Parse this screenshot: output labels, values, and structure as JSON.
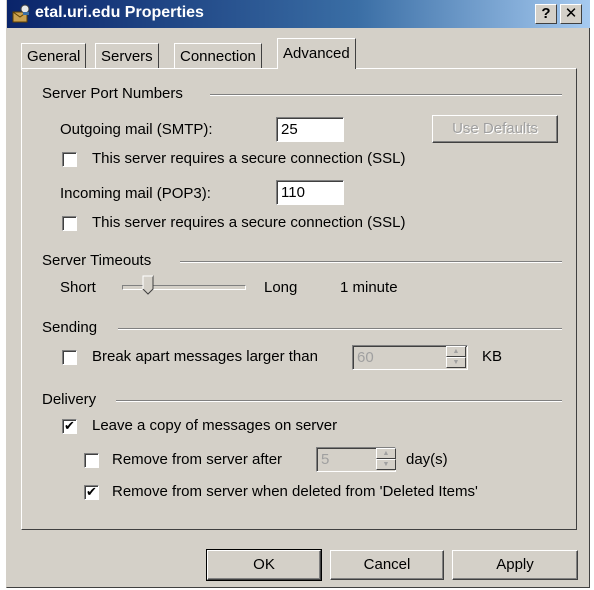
{
  "window": {
    "title": "etal.uri.edu Properties",
    "help_label": "?",
    "close_label": "✕"
  },
  "tabs": [
    {
      "label": "General",
      "active": false
    },
    {
      "label": "Servers",
      "active": false
    },
    {
      "label": "Connection",
      "active": false
    },
    {
      "label": "Advanced",
      "active": true
    }
  ],
  "server_ports": {
    "heading": "Server Port Numbers",
    "smtp_label": "Outgoing mail (SMTP):",
    "smtp_value": "25",
    "use_defaults_label": "Use Defaults",
    "smtp_ssl_label": "This server requires a secure connection (SSL)",
    "smtp_ssl_checked": false,
    "pop3_label": "Incoming mail (POP3):",
    "pop3_value": "110",
    "pop3_ssl_label": "This server requires a secure connection (SSL)",
    "pop3_ssl_checked": false
  },
  "timeouts": {
    "heading": "Server Timeouts",
    "short_label": "Short",
    "long_label": "Long",
    "value_label": "1 minute",
    "slider_fraction": 0.2
  },
  "sending": {
    "heading": "Sending",
    "break_label": "Break apart messages larger than",
    "break_checked": false,
    "break_value": "60",
    "unit_label": "KB"
  },
  "delivery": {
    "heading": "Delivery",
    "leave_copy_label": "Leave a copy of messages on server",
    "leave_copy_checked": true,
    "remove_after_label": "Remove from server after",
    "remove_after_checked": false,
    "remove_after_value": "5",
    "days_label": "day(s)",
    "remove_deleted_label": "Remove from server when deleted from 'Deleted Items'",
    "remove_deleted_checked": true
  },
  "buttons": {
    "ok": "OK",
    "cancel": "Cancel",
    "apply": "Apply"
  },
  "check_mark": "✔"
}
